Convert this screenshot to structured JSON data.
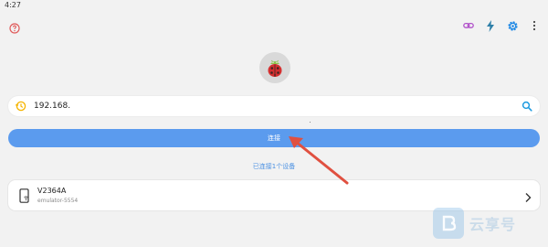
{
  "status_bar": {
    "time": "4:27"
  },
  "top_bar": {
    "help_icon": "help-circle-icon",
    "actions": [
      {
        "name": "link-icon",
        "color": "#b04fc9"
      },
      {
        "name": "flash-icon",
        "color": "#2e7fa8"
      },
      {
        "name": "settings-icon",
        "color": "#1e88e5"
      },
      {
        "name": "more-vert-icon",
        "color": "#444444"
      }
    ]
  },
  "search": {
    "value": "192.168.",
    "history_icon_color": "#f5b400",
    "search_icon_color": "#1e9be0"
  },
  "connect": {
    "label": "连接",
    "color": "#5b9bee"
  },
  "status_text": "已连接1个设备",
  "device": {
    "name": "V2364A",
    "serial": "emulator-5554"
  },
  "annotation": {
    "arrow_color": "#e05040"
  },
  "watermark": {
    "text": "云享号"
  }
}
